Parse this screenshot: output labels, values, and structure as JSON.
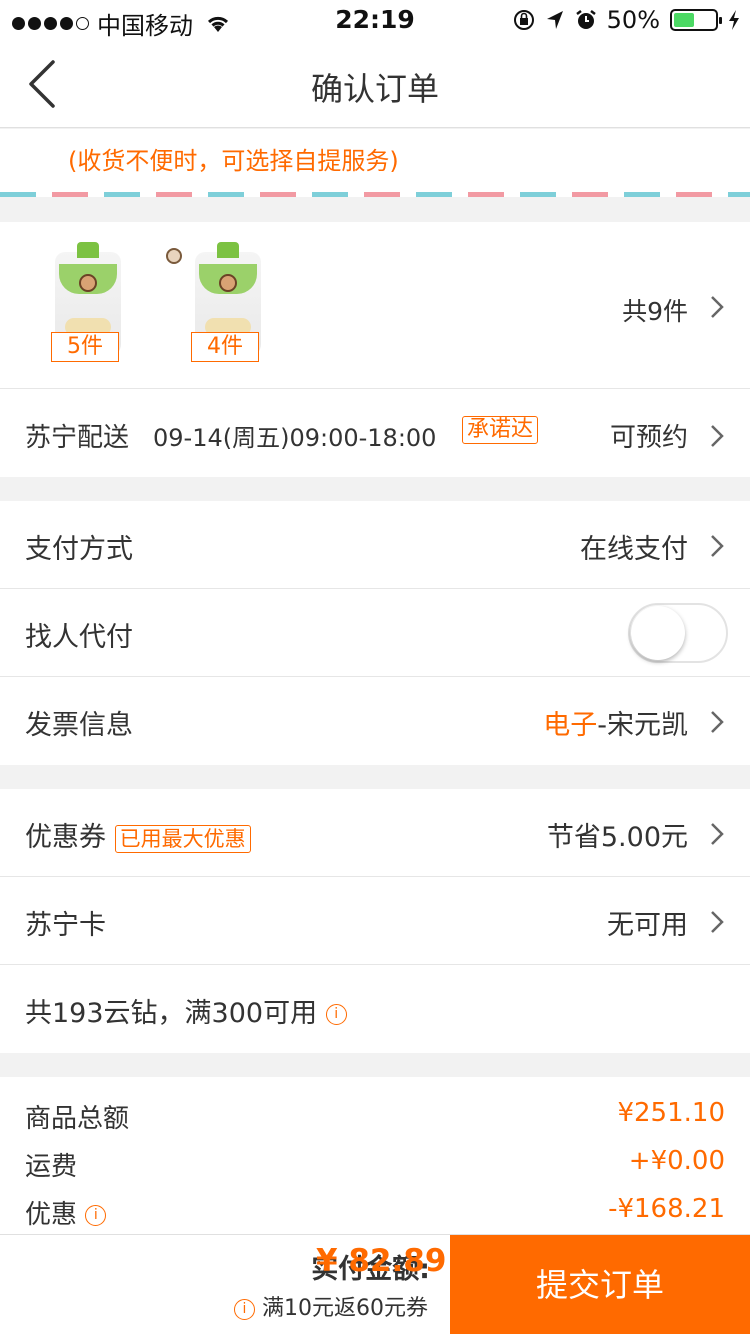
{
  "status_bar": {
    "carrier": "中国移动",
    "time": "22:19",
    "battery": "50%",
    "battery_level": 0.5,
    "colors": {
      "battery_fill": "#4cd964"
    }
  },
  "header": {
    "title": "确认订单"
  },
  "pickup": {
    "tip": "(收货不便时，可选择自提服务)"
  },
  "products": {
    "items": [
      {
        "count": "5件"
      },
      {
        "count": "4件"
      }
    ],
    "total": "共9件"
  },
  "delivery": {
    "label": "苏宁配送",
    "time": "09-14(周五)09:00-18:00",
    "tag": "承诺达",
    "status": "可预约"
  },
  "payment": {
    "method_label": "支付方式",
    "method_value": "在线支付",
    "proxy_label": "找人代付",
    "proxy_enabled": false,
    "invoice_label": "发票信息",
    "invoice_type": "电子",
    "invoice_name": "-宋元凯"
  },
  "discounts": {
    "coupon_label": "优惠券",
    "coupon_tag": "已用最大优惠",
    "coupon_value": "节省5.00元",
    "card_label": "苏宁卡",
    "card_value": "无可用",
    "diamond_text": "共193云钻，满300可用"
  },
  "summary": {
    "goods_label": "商品总额",
    "goods_amount": "¥251.10",
    "shipping_label": "运费",
    "shipping_amount": "+¥0.00",
    "discount_label": "优惠",
    "discount_amount": "-¥168.21"
  },
  "footer": {
    "pay_label": "实付金额:",
    "pay_amount": "¥ 82.89",
    "promo": "满10元返60元券",
    "submit_label": "提交订单"
  },
  "colors": {
    "accent": "#ff6a00",
    "background": "#f2f2f2"
  },
  "icons": [
    "back-arrow-icon",
    "wifi-icon",
    "chevron-right-icon",
    "info-icon",
    "lock-rotation-icon",
    "location-icon",
    "alarm-icon",
    "charging-icon"
  ]
}
